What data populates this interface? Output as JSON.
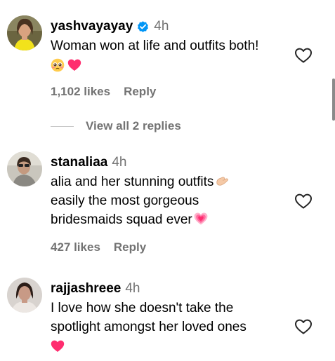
{
  "comments": [
    {
      "username": "yashvayayay",
      "verified": true,
      "time": "4h",
      "lines": [
        "Woman won at life and outfits both!"
      ],
      "emojis": [
        "pleading-face-emoji",
        "pink-heart-emoji"
      ],
      "likes": "1,102 likes",
      "reply": "Reply",
      "view_replies": "View all 2 replies"
    },
    {
      "username": "stanaliaa",
      "verified": false,
      "time": "4h",
      "lines": [
        "alia and her stunning outfits",
        "easily the most gorgeous",
        "bridesmaids squad ever"
      ],
      "emojis": [
        "pinching-hand-emoji",
        "growing-heart-emoji"
      ],
      "likes": "427 likes",
      "reply": "Reply"
    },
    {
      "username": "rajjashreee",
      "verified": false,
      "time": "4h",
      "lines": [
        "I love how she doesn't take the",
        "spotlight amongst her loved ones"
      ],
      "emojis": [
        "pink-heart-emoji"
      ]
    }
  ],
  "colors": {
    "secondary_text": "#737373",
    "verified_badge": "#0095f6",
    "heart": "#ff3b6f"
  },
  "icons": {
    "like": "heart-outline-icon",
    "verified": "verified-badge-icon"
  }
}
